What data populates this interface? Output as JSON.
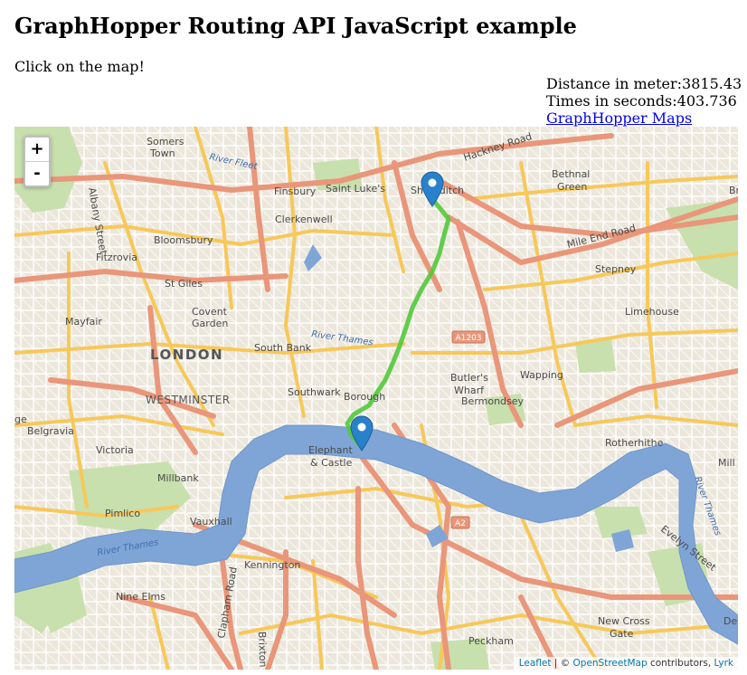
{
  "page": {
    "title": "GraphHopper Routing API JavaScript example",
    "instruction": "Click on the map!"
  },
  "route_info": {
    "distance_text": "Distance in meter:3815.43",
    "time_text": "Times in seconds:403.736",
    "maps_link": "GraphHopper Maps"
  },
  "map": {
    "zoom_in": "+",
    "zoom_out": "-",
    "attribution": {
      "leaflet": "Leaflet",
      "separator": " | © ",
      "osm": "OpenStreetMap",
      "contributors": " contributors, ",
      "lyrk": "Lyrk"
    },
    "colors": {
      "water": "#7fa5d6",
      "route": "#52c93b",
      "marker": "#2a81cb",
      "major_road": "#e9967a",
      "minor_road": "#f7c85a",
      "park": "#c8e0ad"
    },
    "labels": {
      "somers_town": "Somers",
      "somers_town_2": "Town",
      "river_fleet": "River Fleet",
      "hackney_road": "Hackney Road",
      "bethnal": "Bethnal",
      "bethnal_2": "Green",
      "finsbury": "Finsbury",
      "saint_lukes": "Saint Luke's",
      "shoreditch": "Shoreditch",
      "clerkenwell": "Clerkenwell",
      "bloomsbury": "Bloomsbury",
      "mile_end_road": "Mile End Road",
      "fitzrovia": "Fitzrovia",
      "stepney": "Stepney",
      "st_giles": "St Giles",
      "covent": "Covent",
      "covent_2": "Garden",
      "mayfair": "Mayfair",
      "limehouse": "Limehouse",
      "river_thames": "River Thames",
      "a1203": "A1203",
      "london": "LONDON",
      "south_bank": "South Bank",
      "butlers": "Butler's",
      "butlers_2": "Wharf",
      "wapping": "Wapping",
      "westminster": "WESTMINSTER",
      "southwark": "Southwark",
      "borough": "Borough",
      "bermondsey": "Bermondsey",
      "belgravia": "Belgravia",
      "victoria": "Victoria",
      "elephant": "Elephant",
      "elephant_2": "& Castle",
      "rotherhithe": "Rotherhithe",
      "millbank": "Millbank",
      "pimlico": "Pimlico",
      "vauxhall": "Vauxhall",
      "a2": "A2",
      "river_thames_2": "River Thames",
      "evelyn_street": "Evelyn Street",
      "river_thames_3": "River Thames",
      "kennington": "Kennington",
      "nine_elms": "Nine Elms",
      "clapham_road": "Clapham Road",
      "brixton_road": "Brixton Road",
      "new_cross": "New Cross",
      "new_cross_2": "Gate",
      "peckham": "Peckham",
      "albany_street": "Albany Street",
      "mill": "Mill",
      "dept": "Dep",
      "br": "Br",
      "ge": "ge"
    }
  }
}
